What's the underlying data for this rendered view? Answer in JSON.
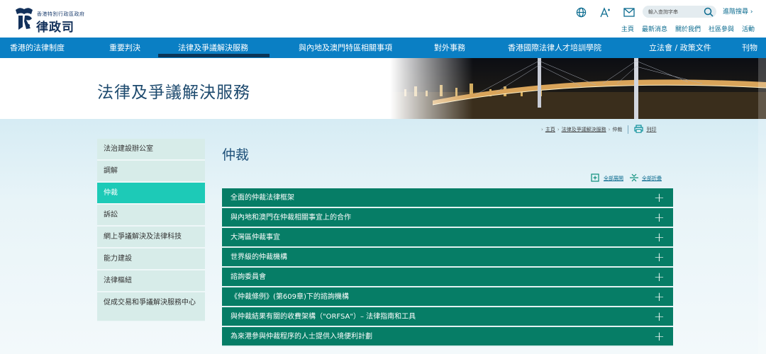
{
  "header": {
    "logo_subtitle": "香港特別行政區政府",
    "logo_title": "律政司",
    "search_placeholder": "輸入查詢字串",
    "advanced_search": "進階搜尋 ›",
    "quick_links": [
      "主頁",
      "最新消息",
      "關於我們",
      "社區參與",
      "活動"
    ]
  },
  "nav": {
    "items": [
      "香港的法律制度",
      "重要判決",
      "法律及爭議解決服務",
      "與內地及澳門特區相關事項",
      "對外事務",
      "香港國際法律人才培訓學院",
      "立法會 / 政策文件",
      "刊物"
    ]
  },
  "banner": {
    "title": "法律及爭議解決服務"
  },
  "breadcrumb": {
    "home": "主頁",
    "parent": "法律及爭議解決服務",
    "current": "仲裁",
    "print": "列印"
  },
  "sidebar": {
    "items": [
      {
        "label": "法治建設辦公室",
        "active": false
      },
      {
        "label": "調解",
        "active": false
      },
      {
        "label": "仲裁",
        "active": true
      },
      {
        "label": "訴訟",
        "active": false
      },
      {
        "label": "網上爭議解決及法律科技",
        "active": false
      },
      {
        "label": "能力建設",
        "active": false
      },
      {
        "label": "法律樞紐",
        "active": false
      },
      {
        "label": "促成交易和爭議解決服務中心",
        "active": false
      }
    ]
  },
  "main": {
    "title": "仲裁",
    "expand_all": "全部展開",
    "collapse_all": "全部折疊",
    "accordion": [
      "全面的仲裁法律框架",
      "與內地和澳門在仲裁相關事宜上的合作",
      "大灣區仲裁事宜",
      "世界級的仲裁機構",
      "諮詢委員會",
      "《仲裁條例》(第609章)下的諮詢機構",
      "與仲裁結果有關的收費架構（\"ORFSA\"）– 法律指南和工具",
      "為來港參與仲裁程序的人士提供入境便利計劃"
    ]
  },
  "colors": {
    "nav": "#0a7fc4",
    "accordion": "#067d66",
    "sidebar_active": "#1dcab7",
    "sidebar": "#d7ece9"
  }
}
